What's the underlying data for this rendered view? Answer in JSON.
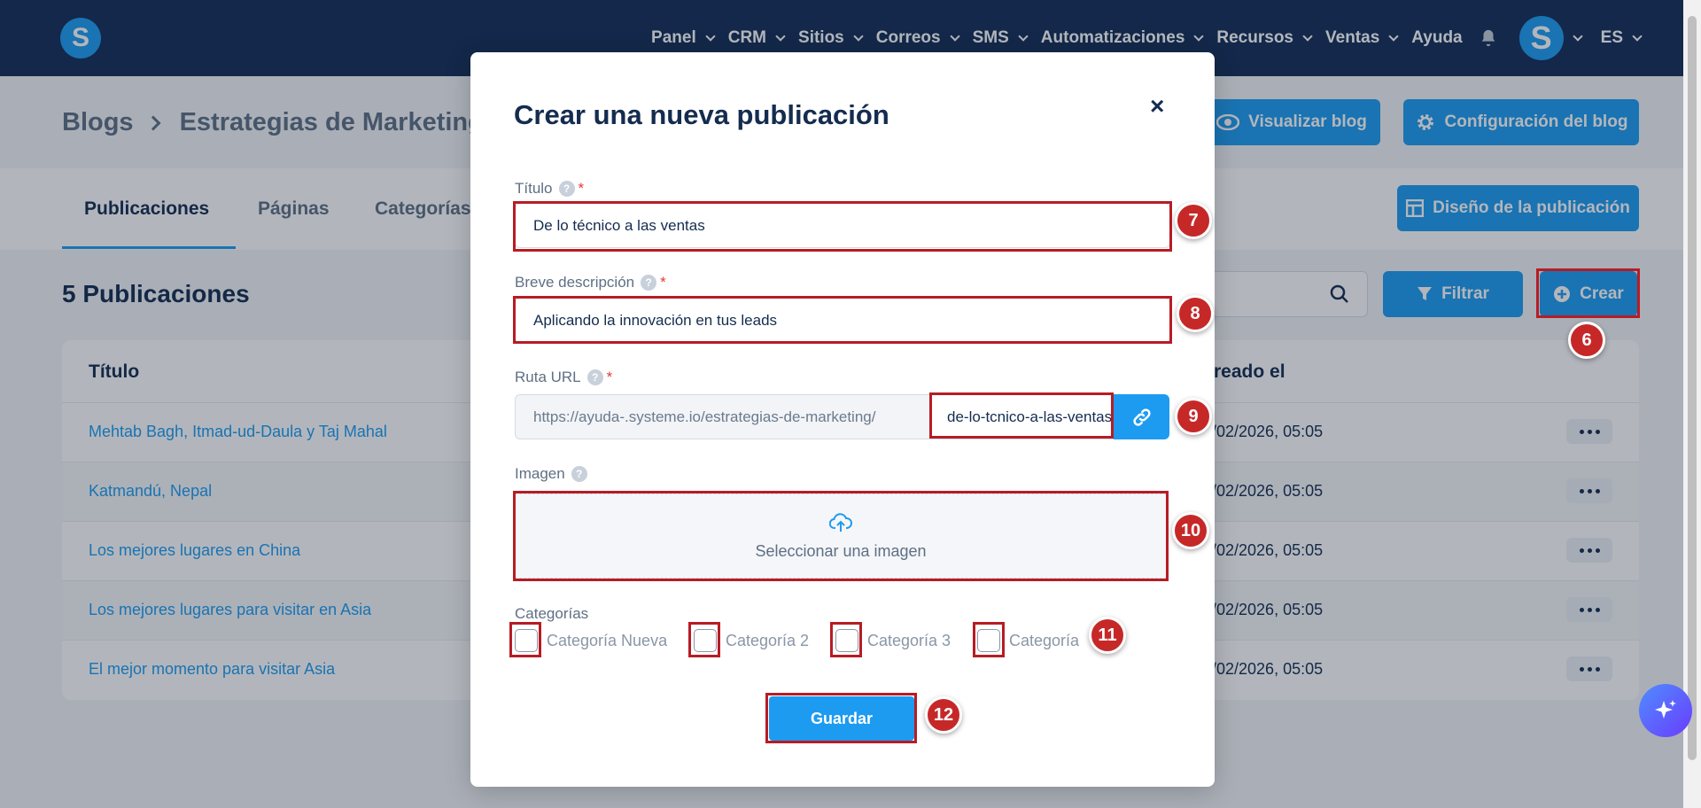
{
  "nav": {
    "items": [
      "Panel",
      "CRM",
      "Sitios",
      "Correos",
      "SMS",
      "Automatizaciones",
      "Recursos",
      "Ventas"
    ],
    "help": "Ayuda",
    "avatar_letter": "S",
    "language": "ES",
    "logo_letter": "S"
  },
  "page": {
    "breadcrumb_root": "Blogs",
    "breadcrumb_current": "Estrategias de Marketing",
    "view_blog": "Visualizar blog",
    "blog_settings": "Configuración del blog",
    "tabs": [
      "Publicaciones",
      "Páginas",
      "Categorías"
    ],
    "post_design": "Diseño de la publicación",
    "count_title": "5 Publicaciones",
    "filter": "Filtrar",
    "create": "Crear",
    "col_title": "Título",
    "col_created": "reado el",
    "rows": [
      {
        "title": "Mehtab Bagh, Itmad-ud-Daula y Taj Mahal",
        "date": "/02/2026, 05:05"
      },
      {
        "title": "Katmandú, Nepal",
        "date": "/02/2026, 05:05"
      },
      {
        "title": "Los mejores lugares en China",
        "date": "/02/2026, 05:05"
      },
      {
        "title": "Los mejores lugares para visitar en Asia",
        "date": "/02/2026, 05:05"
      },
      {
        "title": "El mejor momento para visitar Asia",
        "date": "/02/2026, 05:05"
      }
    ]
  },
  "modal": {
    "title": "Crear una nueva publicación",
    "close": "×",
    "title_label": "Título",
    "title_value": "De lo técnico a las ventas",
    "desc_label": "Breve descripción",
    "desc_value": "Aplicando la innovación en tus leads",
    "url_label": "Ruta URL",
    "url_prefix": "https://ayuda-.systeme.io/estrategias-de-marketing/",
    "url_slug": "de-lo-tcnico-a-las-ventas",
    "image_label": "Imagen",
    "image_select": "Seleccionar una imagen",
    "categories_label": "Categorías",
    "categories": [
      "Categoría Nueva",
      "Categoría 2",
      "Categoría 3",
      "Categoría"
    ],
    "save": "Guardar",
    "help_glyph": "?",
    "required_mark": "*"
  },
  "badges": [
    "6",
    "7",
    "8",
    "9",
    "10",
    "11",
    "12"
  ],
  "colors": {
    "navy": "#132c56",
    "accent": "#1d9bf0",
    "highlight": "#b71c25"
  }
}
